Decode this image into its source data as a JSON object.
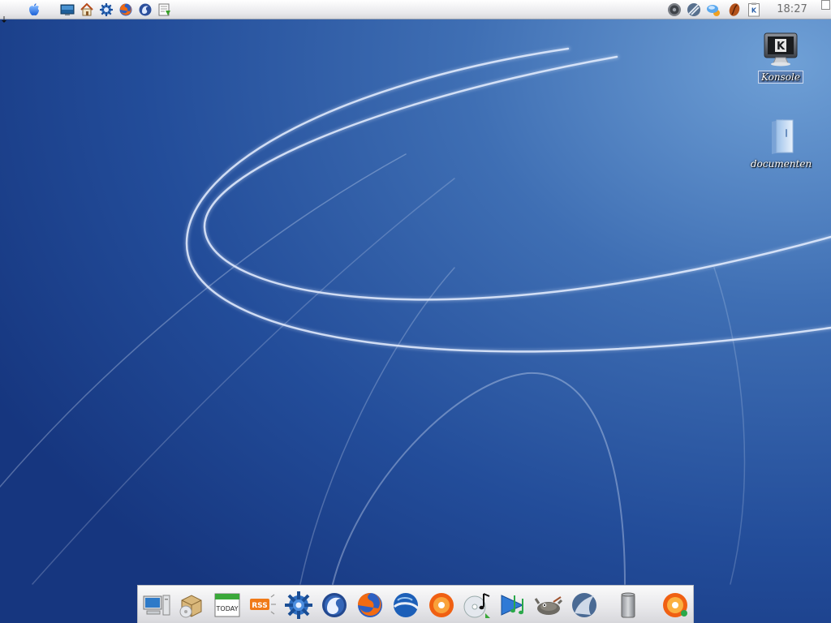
{
  "top_panel": {
    "clock": "18:27",
    "launchers": [
      "apple-menu-icon",
      "show-desktop-icon",
      "home-folder-icon",
      "kde-control-center-icon",
      "firefox-icon",
      "thunderbird-icon",
      "update-manager-icon"
    ],
    "tray": [
      "speaker-volume-icon",
      "network-icon",
      "weather-icon",
      "java-coffee-icon",
      "klipper-clipboard-icon"
    ]
  },
  "desktop": {
    "icons": [
      {
        "label": "Konsole",
        "icon": "terminal-monitor-icon",
        "selected": true
      },
      {
        "label": "documenten",
        "icon": "documents-folder-icon",
        "selected": false
      }
    ]
  },
  "dock": {
    "items": [
      "computer-icon",
      "software-installer-icon",
      "calendar-today-icon",
      "rss-reader-icon",
      "kde-control-center-icon",
      "thunderbird-icon",
      "firefox-icon",
      "google-earth-icon",
      "ubuntu-cd-icon",
      "music-cd-icon",
      "media-player-icon",
      "gimp-icon",
      "network-sharing-icon",
      "trash-icon",
      "cd-burner-icon"
    ],
    "calendar_label": "TODAY",
    "rss_label": "RSS"
  },
  "colors": {
    "wallpaper": "#1b3f8a",
    "panel": "#e9e9ec",
    "label_text": "#ffffff"
  }
}
